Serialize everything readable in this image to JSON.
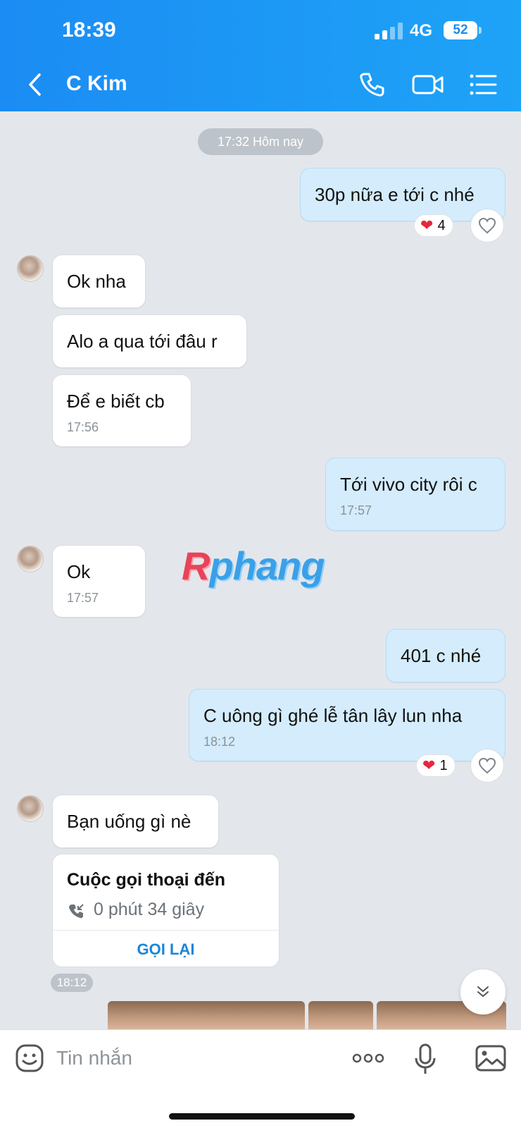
{
  "status_bar": {
    "time": "18:39",
    "network": "4G",
    "battery": "52"
  },
  "header": {
    "contact_name": "C Kim",
    "icons": [
      "back-chevron-icon",
      "phone-icon",
      "video-camera-icon",
      "list-menu-icon"
    ]
  },
  "date_separator": "17:32 Hôm nay",
  "messages": [
    {
      "side": "out",
      "text": "30p nữa e tới c nhé",
      "time": "",
      "reaction_count": "4"
    },
    {
      "side": "in",
      "text": "Ok nha",
      "time": ""
    },
    {
      "side": "in",
      "text": "Alo a qua tới đâu r",
      "time": ""
    },
    {
      "side": "in",
      "text": "Để e biết cb",
      "time": "17:56"
    },
    {
      "side": "out",
      "text": "Tới vivo city rôi c",
      "time": "17:57"
    },
    {
      "side": "in",
      "text": "Ok",
      "time": "17:57"
    },
    {
      "side": "out",
      "text": "401 c nhé",
      "time": ""
    },
    {
      "side": "out",
      "text": "C uông gì ghé lễ tân lây lun nha",
      "time": "18:12",
      "reaction_count": "1"
    },
    {
      "side": "in",
      "text": "Bạn uống gì nè",
      "time": ""
    }
  ],
  "call_card": {
    "title": "Cuộc gọi thoại đến",
    "duration": "0 phút 34 giây",
    "action": "GỌI LẠI",
    "time": "18:12"
  },
  "watermark": {
    "part1": "R",
    "part2": "phang"
  },
  "composer": {
    "placeholder": "Tin nhắn"
  },
  "colors": {
    "header_blue": "#1b8cf3",
    "outgoing_bubble": "#d4ecfc",
    "incoming_bubble": "#ffffff",
    "chat_background": "#e3e7ec",
    "heart": "#e9263d",
    "link_blue": "#1a86d6"
  }
}
